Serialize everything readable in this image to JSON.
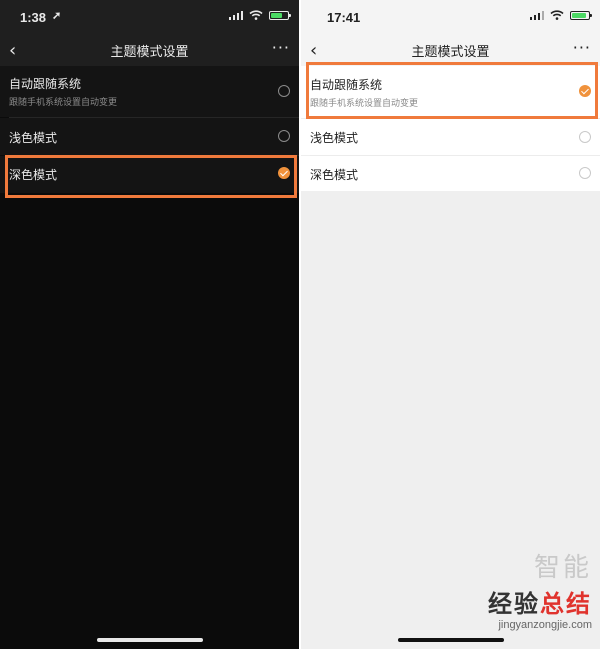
{
  "left": {
    "status": {
      "time": "1:38",
      "location_arrow": "➚"
    },
    "nav": {
      "back": "‹",
      "title": "主题模式设置",
      "more": "···"
    },
    "options": [
      {
        "label": "自动跟随系统",
        "sub": "跟随手机系统设置自动变更",
        "checked": false
      },
      {
        "label": "浅色模式",
        "checked": false
      },
      {
        "label": "深色模式",
        "checked": true
      }
    ]
  },
  "right": {
    "status": {
      "time": "17:41"
    },
    "nav": {
      "back": "‹",
      "title": "主题模式设置",
      "more": "···"
    },
    "options": [
      {
        "label": "自动跟随系统",
        "sub": "跟随手机系统设置自动变更",
        "checked": true
      },
      {
        "label": "浅色模式",
        "checked": false
      },
      {
        "label": "深色模式",
        "checked": false
      }
    ]
  },
  "watermark": {
    "top": "智能",
    "main_a": "经验",
    "main_b": "总结",
    "url": "jingyanzongjie.com"
  },
  "colors": {
    "accent": "#f0923c",
    "highlight": "#f07a3c",
    "dark_bg": "#0b0b0b",
    "light_bg": "#efefef"
  }
}
